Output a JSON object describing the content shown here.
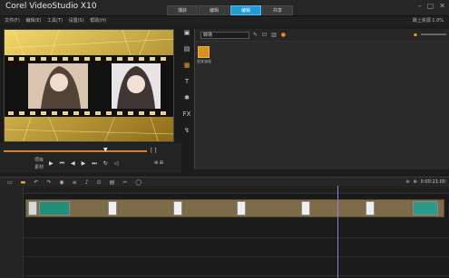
{
  "app": {
    "title": "Corel VideoStudio X10"
  },
  "tabs": [
    {
      "label": "捕获",
      "active": false
    },
    {
      "label": "编辑",
      "active": false
    },
    {
      "label": "编辑",
      "active": true
    },
    {
      "label": "共享",
      "active": false
    }
  ],
  "menu": {
    "items": [
      "文件(F)",
      "编辑(E)",
      "工具(T)",
      "设置(S)",
      "帮助(H)"
    ],
    "right": "跳上资源 1.0%"
  },
  "library": {
    "dropdown": "转场",
    "thumb_label": "交叉淡化"
  },
  "player": {
    "labels": {
      "project": "项目",
      "clip": "素材"
    }
  },
  "timeline": {
    "timecode": "0:00:21:00"
  },
  "colors": {
    "accent": "#1f9bd8",
    "clip_track": "#7c6a49",
    "filmstrip_frame": "#b8962a"
  }
}
